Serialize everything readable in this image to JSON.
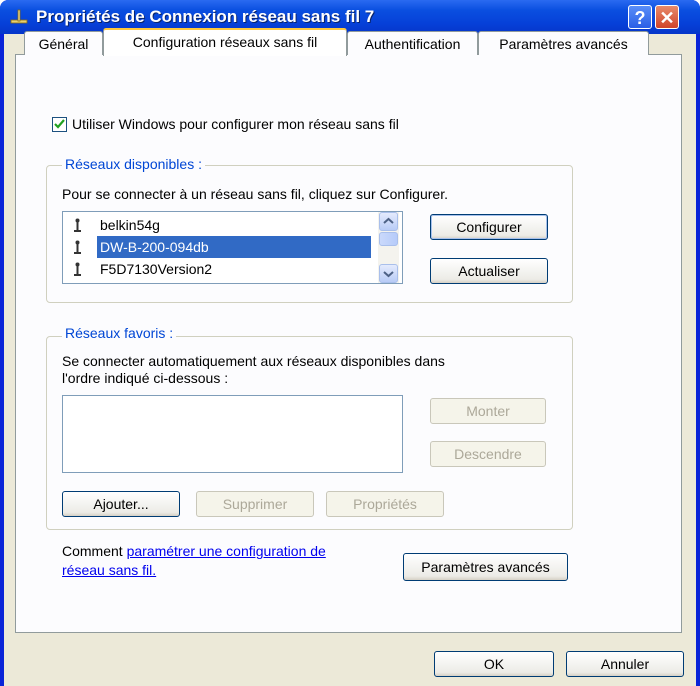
{
  "window": {
    "title": "Propriétés de Connexion réseau sans fil 7",
    "help_label": "?",
    "close_label": "✕"
  },
  "tabs": [
    {
      "label": "Général"
    },
    {
      "label": "Configuration réseaux sans fil"
    },
    {
      "label": "Authentification"
    },
    {
      "label": "Paramètres avancés"
    }
  ],
  "use_windows": {
    "label": "Utiliser Windows pour configurer mon réseau sans fil",
    "checked": true
  },
  "available": {
    "title": "Réseaux disponibles :",
    "description": "Pour se connecter à un réseau sans fil, cliquez sur Configurer.",
    "networks": [
      "belkin54g",
      "DW-B-200-094db",
      "F5D7130Version2"
    ],
    "selected": "DW-B-200-094db",
    "configure_label": "Configurer",
    "refresh_label": "Actualiser"
  },
  "favorites": {
    "title": "Réseaux favoris :",
    "description_1": "Se connecter automatiquement aux réseaux disponibles dans",
    "description_2": "l'ordre indiqué ci-dessous :",
    "up_label": "Monter",
    "down_label": "Descendre",
    "add_label": "Ajouter...",
    "remove_label": "Supprimer",
    "properties_label": "Propriétés"
  },
  "help_text": {
    "prefix": "Comment ",
    "link_1": "paramétrer une configuration de",
    "link_2": "réseau sans fil."
  },
  "advanced_label": "Paramètres avancés",
  "footer": {
    "ok_label": "OK",
    "cancel_label": "Annuler"
  },
  "colors": {
    "titlebar": "#0a4fe0",
    "group_title": "#0046d5",
    "selection": "#316ac5",
    "dialog": "#ece9d8"
  }
}
